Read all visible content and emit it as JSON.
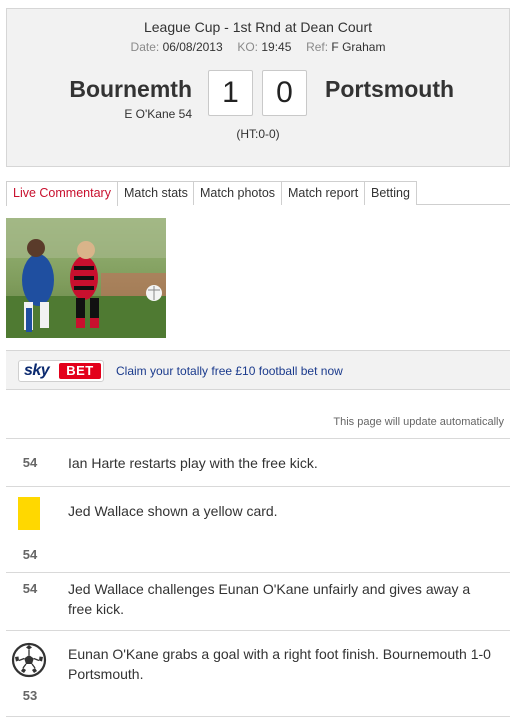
{
  "match": {
    "competition": "League Cup - 1st Rnd at Dean Court",
    "date_label": "Date:",
    "date": "06/08/2013",
    "ko_label": "KO:",
    "ko": "19:45",
    "ref_label": "Ref:",
    "ref": "F Graham",
    "home_team": "Bournemth",
    "away_team": "Portsmouth",
    "home_score": "1",
    "away_score": "0",
    "home_scorers": "E O'Kane 54",
    "half_time": "(HT:0-0)"
  },
  "tabs": [
    {
      "label": "Live Commentary",
      "active": true
    },
    {
      "label": "Match stats",
      "active": false
    },
    {
      "label": "Match photos",
      "active": false
    },
    {
      "label": "Match report",
      "active": false
    },
    {
      "label": "Betting",
      "active": false
    }
  ],
  "promo": {
    "logo_sky": "sky",
    "logo_bet": "BET",
    "text": "Claim your totally free £10 football bet now"
  },
  "auto_update_note": "This page will update automatically",
  "commentary": [
    {
      "minute": "54",
      "icon": "",
      "text": "Ian Harte restarts play with the free kick."
    },
    {
      "minute": "54",
      "icon": "yellow-card-icon",
      "text": "Jed Wallace shown a yellow card."
    },
    {
      "minute": "54",
      "icon": "",
      "text": "Jed Wallace challenges Eunan O'Kane unfairly and gives away a free kick."
    },
    {
      "minute": "53",
      "icon": "football-icon",
      "text": "Eunan O'Kane grabs a goal with a right foot finish. Bournemouth 1-0 Portsmouth."
    }
  ],
  "colors": {
    "accent_red": "#c8102e",
    "link_blue": "#1a3a8c",
    "yellow_card": "#ffd800",
    "skybet_red": "#e3001b",
    "skybet_navy": "#0b2a6f"
  }
}
